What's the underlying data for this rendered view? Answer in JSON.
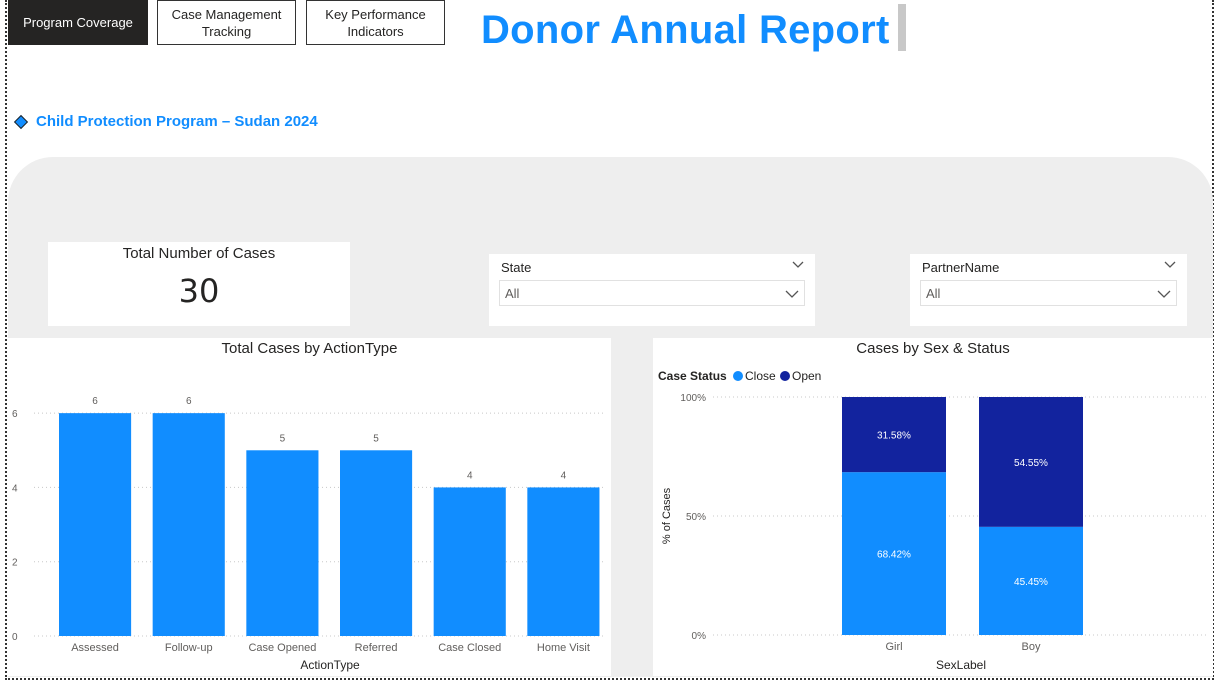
{
  "nav": {
    "program_coverage": "Program Coverage",
    "case_management": "Case Management Tracking",
    "kpi": "Key Performance Indicators"
  },
  "header": {
    "title": "Donor Annual Report"
  },
  "subtitle": "Child Protection Program – Sudan 2024",
  "kpi_card": {
    "label": "Total Number of Cases",
    "value": "30"
  },
  "slicers": {
    "state": {
      "label": "State",
      "value": "All"
    },
    "partner": {
      "label": "PartnerName",
      "value": "All"
    }
  },
  "colors": {
    "accent": "#118DFF",
    "close": "#118DFF",
    "open": "#12239E"
  },
  "chart_data": [
    {
      "type": "bar",
      "title": "Total Cases by ActionType",
      "xlabel": "ActionType",
      "ylabel": "",
      "categories": [
        "Assessed",
        "Follow-up",
        "Case Opened",
        "Referred",
        "Case Closed",
        "Home Visit"
      ],
      "values": [
        6,
        6,
        5,
        5,
        4,
        4
      ],
      "yticks": [
        0,
        2,
        4,
        6
      ],
      "ylim": [
        0,
        7
      ],
      "grid": true
    },
    {
      "type": "bar",
      "stacked": "100%",
      "title": "Cases by Sex & Status",
      "xlabel": "SexLabel",
      "ylabel": "% of Cases",
      "legend_title": "Case Status",
      "legend_position": "top-left",
      "categories": [
        "Girl",
        "Boy"
      ],
      "series": [
        {
          "name": "Close",
          "values": [
            68.42,
            45.45
          ],
          "labels": [
            "68.42%",
            "45.45%"
          ]
        },
        {
          "name": "Open",
          "values": [
            31.58,
            54.55
          ],
          "labels": [
            "31.58%",
            "54.55%"
          ]
        }
      ],
      "yticks": [
        "0%",
        "50%",
        "100%"
      ],
      "ylim": [
        0,
        100
      ],
      "grid": true
    }
  ]
}
